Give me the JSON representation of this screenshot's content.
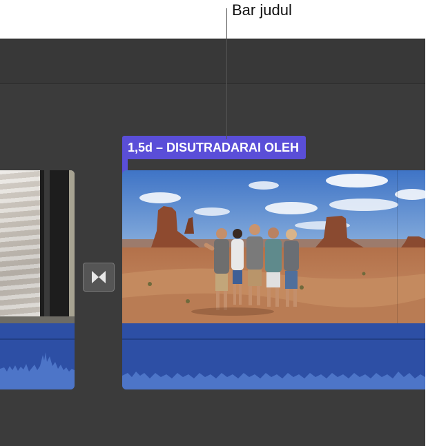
{
  "callout": {
    "label": "Bar judul"
  },
  "title_bar": {
    "text": "1,5d – DISUTRADARAI OLEH"
  },
  "colors": {
    "title_bar": "#5a4ed8",
    "audio": "#2d4fa5",
    "timeline_bg": "#3b3b3b"
  },
  "icons": {
    "transition": "transition-bowtie-icon"
  }
}
